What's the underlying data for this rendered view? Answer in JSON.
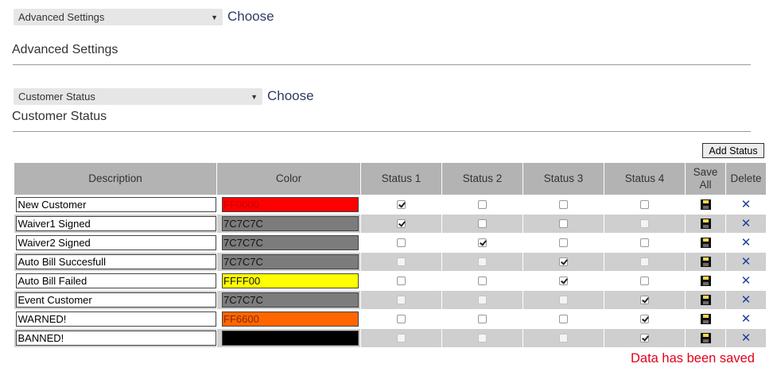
{
  "top_select": {
    "value": "Advanced Settings",
    "choose_label": "Choose"
  },
  "section1_title": "Advanced Settings",
  "status_select": {
    "value": "Customer Status",
    "choose_label": "Choose"
  },
  "section2_title": "Customer Status",
  "add_status_label": "Add Status",
  "table": {
    "headers": {
      "description": "Description",
      "color": "Color",
      "status1": "Status 1",
      "status2": "Status 2",
      "status3": "Status 3",
      "status4": "Status 4",
      "save_all_line1": "Save",
      "save_all_line2": "All",
      "delete": "Delete"
    },
    "rows": [
      {
        "description": "New Customer",
        "color": "FF0000",
        "bg": "#ff0000",
        "fg": "#cc0000",
        "status": [
          true,
          false,
          false,
          false
        ],
        "enabled": [
          true,
          true,
          true,
          true
        ]
      },
      {
        "description": "Waiver1 Signed",
        "color": "7C7C7C",
        "bg": "#7c7c7c",
        "fg": "#111111",
        "status": [
          true,
          false,
          false,
          false
        ],
        "enabled": [
          true,
          true,
          true,
          false
        ]
      },
      {
        "description": "Waiver2 Signed",
        "color": "7C7C7C",
        "bg": "#7c7c7c",
        "fg": "#111111",
        "status": [
          false,
          true,
          false,
          false
        ],
        "enabled": [
          true,
          true,
          true,
          true
        ]
      },
      {
        "description": "Auto Bill Succesfull",
        "color": "7C7C7C",
        "bg": "#7c7c7c",
        "fg": "#111111",
        "status": [
          false,
          false,
          true,
          false
        ],
        "enabled": [
          false,
          false,
          true,
          false
        ]
      },
      {
        "description": "Auto Bill Failed",
        "color": "FFFF00",
        "bg": "#ffff00",
        "fg": "#111111",
        "status": [
          false,
          false,
          true,
          false
        ],
        "enabled": [
          true,
          true,
          true,
          true
        ]
      },
      {
        "description": "Event Customer",
        "color": "7C7C7C",
        "bg": "#7c7c7c",
        "fg": "#111111",
        "status": [
          false,
          false,
          false,
          true
        ],
        "enabled": [
          false,
          false,
          false,
          true
        ]
      },
      {
        "description": "WARNED!",
        "color": "FF6600",
        "bg": "#ff6600",
        "fg": "#8a2a00",
        "status": [
          false,
          false,
          false,
          true
        ],
        "enabled": [
          true,
          true,
          true,
          true
        ]
      },
      {
        "description": "BANNED!",
        "color": "000000",
        "bg": "#000000",
        "fg": "#000000",
        "status": [
          false,
          false,
          false,
          true
        ],
        "enabled": [
          false,
          false,
          false,
          true
        ]
      }
    ]
  },
  "saved_message": "Data has been saved",
  "icons": {
    "save": "floppy-disk-icon",
    "delete": "close-x-icon"
  }
}
